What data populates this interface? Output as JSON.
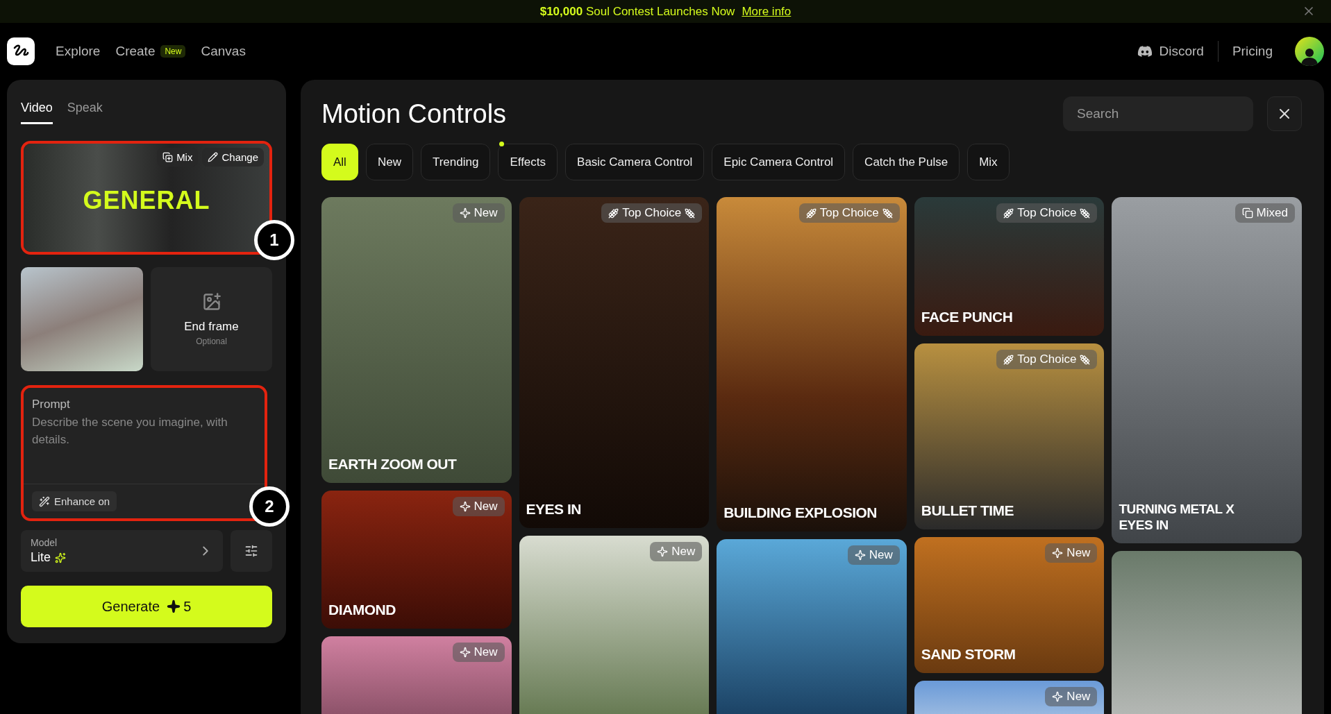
{
  "banner": {
    "text": "**$10,000** Soul Contest Launches Now",
    "link": "More info"
  },
  "nav": {
    "items": [
      {
        "label": "Explore"
      },
      {
        "label": "Create",
        "badge": "New"
      },
      {
        "label": "Canvas"
      }
    ],
    "discord": "Discord",
    "pricing": "Pricing"
  },
  "left_panel": {
    "tabs": [
      {
        "label": "Video",
        "selected": true
      },
      {
        "label": "Speak",
        "selected": false
      }
    ],
    "preset": {
      "title": "GENERAL",
      "marker": "1",
      "buttons": [
        {
          "kind": "mix",
          "label": "Mix"
        },
        {
          "kind": "change",
          "label": "Change"
        }
      ]
    },
    "end_frame": {
      "label": "End frame",
      "hint": "Optional"
    },
    "prompt": {
      "label": "Prompt",
      "placeholder": "Describe the scene you imagine, with details.",
      "enhance": "Enhance on",
      "marker": "2"
    },
    "model": {
      "label": "Model",
      "value": "Lite"
    },
    "generate": {
      "label": "Generate",
      "cost": "5"
    }
  },
  "gallery": {
    "title": "Motion Controls",
    "search": {
      "placeholder": "Search"
    },
    "filters": [
      {
        "label": "All",
        "selected": true,
        "dot": false
      },
      {
        "label": "New",
        "selected": false,
        "dot": false
      },
      {
        "label": "Trending",
        "selected": false,
        "dot": false
      },
      {
        "label": "Effects",
        "selected": false,
        "dot": true
      },
      {
        "label": "Basic Camera Control",
        "selected": false,
        "dot": false
      },
      {
        "label": "Epic Camera Control",
        "selected": false,
        "dot": false
      },
      {
        "label": "Catch the Pulse",
        "selected": false,
        "dot": false
      },
      {
        "label": "Mix",
        "selected": false,
        "dot": false
      }
    ],
    "columns": [
      [
        {
          "title": "EARTH ZOOM OUT",
          "badge": {
            "kind": "new",
            "label": "New"
          }
        },
        {
          "title": "DIAMOND",
          "badge": {
            "kind": "new",
            "label": "New"
          }
        },
        {
          "badge": {
            "kind": "new",
            "label": "New"
          }
        }
      ],
      [
        {
          "title": "EYES IN",
          "badge": {
            "kind": "top",
            "label": "Top Choice"
          }
        },
        {
          "badge": {
            "kind": "new",
            "label": "New"
          }
        }
      ],
      [
        {
          "title": "BUILDING EXPLOSION",
          "badge": {
            "kind": "top",
            "label": "Top Choice"
          }
        },
        {
          "badge": {
            "kind": "new",
            "label": "New"
          }
        }
      ],
      [
        {
          "title": "FACE PUNCH",
          "badge": {
            "kind": "top",
            "label": "Top Choice"
          }
        },
        {
          "title": "BULLET TIME",
          "badge": {
            "kind": "top",
            "label": "Top Choice"
          }
        },
        {
          "title": "SAND STORM",
          "badge": {
            "kind": "new",
            "label": "New"
          }
        },
        {
          "badge": {
            "kind": "new",
            "label": "New"
          }
        }
      ],
      [
        {
          "title": "TURNING METAL X EYES IN",
          "badge": {
            "kind": "mixed",
            "label": "Mixed"
          }
        },
        {}
      ]
    ]
  }
}
